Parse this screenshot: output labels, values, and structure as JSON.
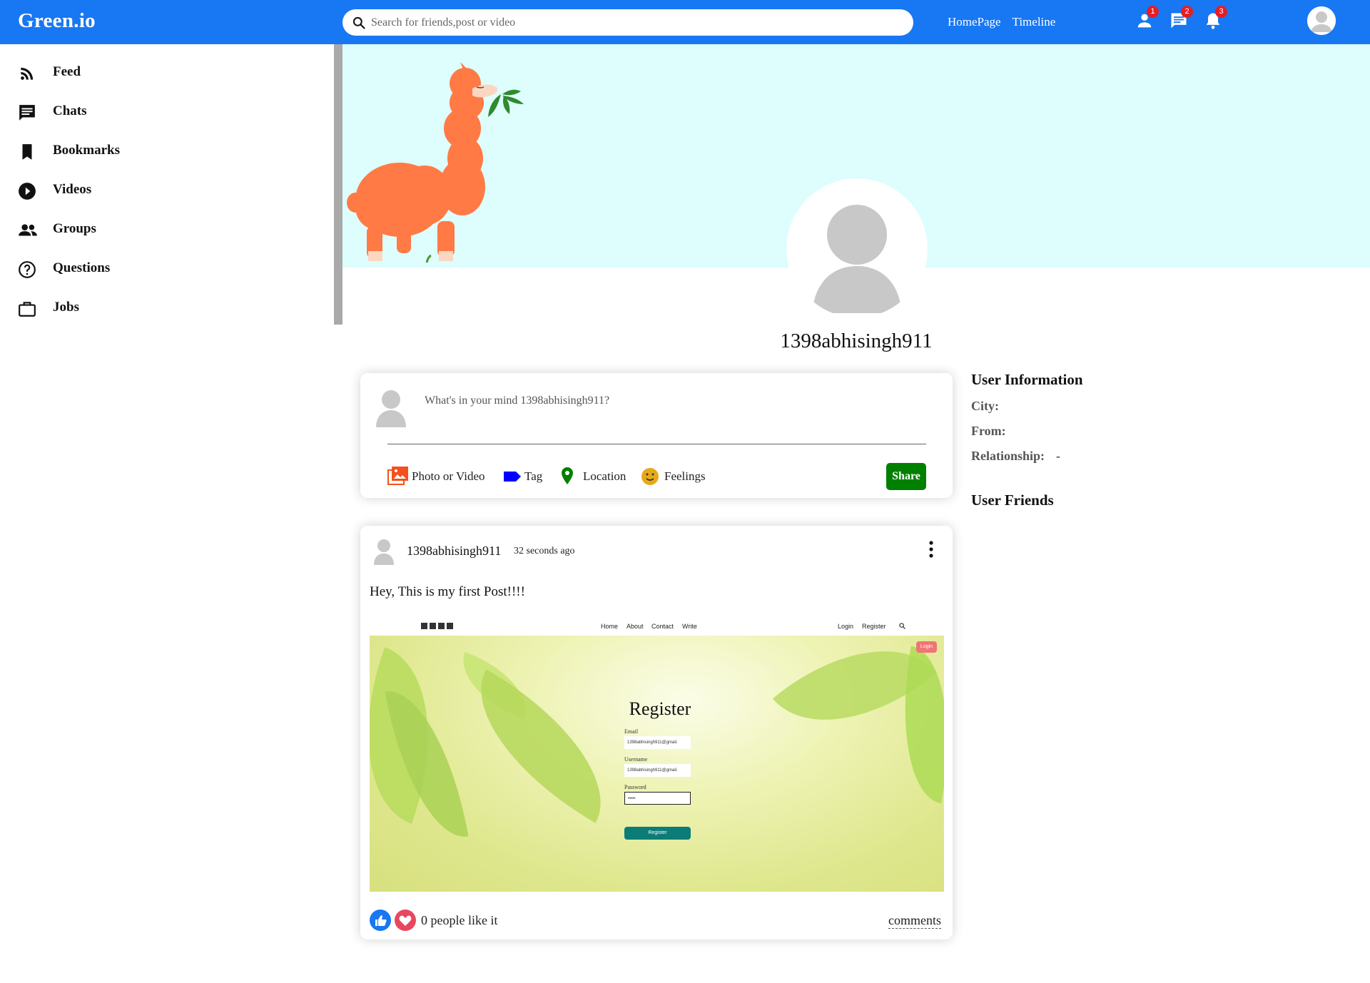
{
  "topbar": {
    "logo": "Green.io",
    "search_placeholder": "Search for friends,post or video",
    "links": [
      "HomePage",
      "Timeline"
    ],
    "badges": {
      "friends": "1",
      "messages": "2",
      "notifications": "3"
    }
  },
  "sidebar": {
    "items": [
      {
        "label": "Feed",
        "icon": "rss-feed-icon"
      },
      {
        "label": "Chats",
        "icon": "chat-icon"
      },
      {
        "label": "Bookmarks",
        "icon": "bookmark-icon"
      },
      {
        "label": "Videos",
        "icon": "play-circle-icon"
      },
      {
        "label": "Groups",
        "icon": "group-icon"
      },
      {
        "label": "Questions",
        "icon": "help-circle-icon"
      },
      {
        "label": "Jobs",
        "icon": "briefcase-icon"
      }
    ]
  },
  "profile": {
    "username": "1398abhisingh911"
  },
  "share": {
    "placeholder": "What's in your mind 1398abhisingh911?",
    "options": [
      {
        "label": "Photo or Video",
        "icon": "photo-icon",
        "color": "#f4511e"
      },
      {
        "label": "Tag",
        "icon": "label-icon",
        "color": "#0000ff"
      },
      {
        "label": "Location",
        "icon": "location-pin-icon",
        "color": "#008000"
      },
      {
        "label": "Feelings",
        "icon": "emoji-icon",
        "color": "#e6a917"
      }
    ],
    "button": "Share"
  },
  "info": {
    "title": "User Information",
    "city_label": "City:",
    "from_label": "From:",
    "relationship_label": "Relationship:",
    "relationship_value": "-",
    "friends_title": "User Friends"
  },
  "post": {
    "username": "1398abhisingh911",
    "time": "32 seconds ago",
    "text": "Hey, This is my first Post!!!!",
    "likes": "0 people like it",
    "comments": "comments",
    "image": {
      "nav_links": [
        "Home",
        "About",
        "Contact",
        "Write"
      ],
      "nav_right": [
        "Login",
        "Register"
      ],
      "login_button": "Login",
      "title": "Register",
      "email_label": "Email",
      "email_value": "1398abhisingh911@gmail.",
      "username_label": "Username",
      "username_value": "1398abhisingh911@gmail.",
      "password_label": "Password",
      "password_value": "•••••",
      "register_button": "Register"
    }
  },
  "colors": {
    "topbar": "#1877f2",
    "cover": "#defdfd",
    "share_button": "#008000",
    "badge": "#e41e26"
  }
}
